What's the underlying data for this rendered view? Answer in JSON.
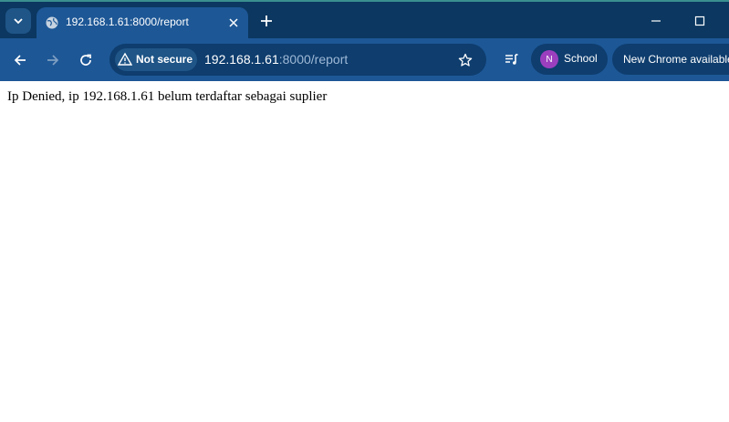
{
  "tab": {
    "title": "192.168.1.61:8000/report"
  },
  "address_bar": {
    "security_label": "Not secure",
    "url_host": "192.168.1.61",
    "url_rest": ":8000/report"
  },
  "profile": {
    "initial": "N",
    "name": "School",
    "avatar_color": "#9b3fbf"
  },
  "update_button": {
    "label": "New Chrome available"
  },
  "page": {
    "message": "Ip Denied, ip 192.168.1.61 belum terdaftar sebagai suplier"
  },
  "colors": {
    "tabbar": "#0b3760",
    "toolbar": "#1d5796",
    "omnibox": "#0e3d6e"
  },
  "icons": [
    "chevron-down-icon",
    "globe-icon",
    "close-icon",
    "plus-icon",
    "minimize-icon",
    "maximize-icon",
    "back-arrow-icon",
    "forward-arrow-icon",
    "reload-icon",
    "warning-icon",
    "star-icon",
    "media-playlist-icon"
  ]
}
